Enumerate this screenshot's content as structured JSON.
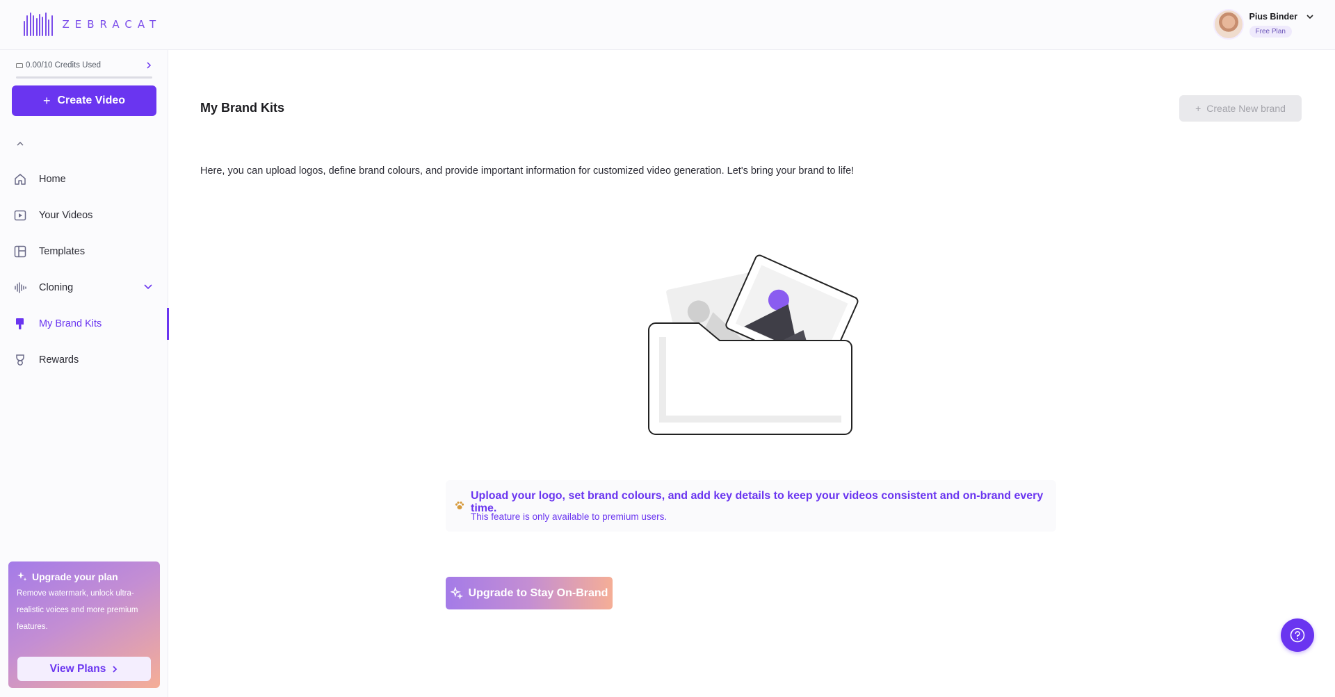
{
  "app": {
    "logo_text": "ZEBRACAT"
  },
  "user": {
    "name": "Pius Binder",
    "plan": "Free Plan"
  },
  "sidebar": {
    "credits_label": "0.00/10 Credits Used",
    "credits_progress": 0.0,
    "create_video_label": "Create Video",
    "items": [
      {
        "label": "Home",
        "icon": "home-icon"
      },
      {
        "label": "Your Videos",
        "icon": "video-icon"
      },
      {
        "label": "Templates",
        "icon": "templates-icon"
      },
      {
        "label": "Cloning",
        "icon": "waveform-icon"
      },
      {
        "label": "My Brand Kits",
        "icon": "brush-icon",
        "active": true
      },
      {
        "label": "Rewards",
        "icon": "trophy-icon"
      }
    ],
    "upgrade": {
      "title": "Upgrade your plan",
      "description": "Remove watermark, unlock ultra-realistic voices and more premium features.",
      "button_label": "View Plans"
    }
  },
  "main": {
    "title": "My Brand Kits",
    "create_brand_label": "Create New brand",
    "intro": "Here, you can upload logos, define brand colours, and provide important information for customized video generation. Let's bring your brand to life!",
    "info_title": "Upload your logo, set brand colours, and add key details to keep your videos consistent and on-brand every time.",
    "info_sub": "This feature is only available to premium users.",
    "upgrade_button_label": "Upgrade to Stay On-Brand"
  },
  "colors": {
    "accent": "#6a35f0",
    "gradient_start": "#a47be8",
    "gradient_end": "#f5ae96"
  }
}
